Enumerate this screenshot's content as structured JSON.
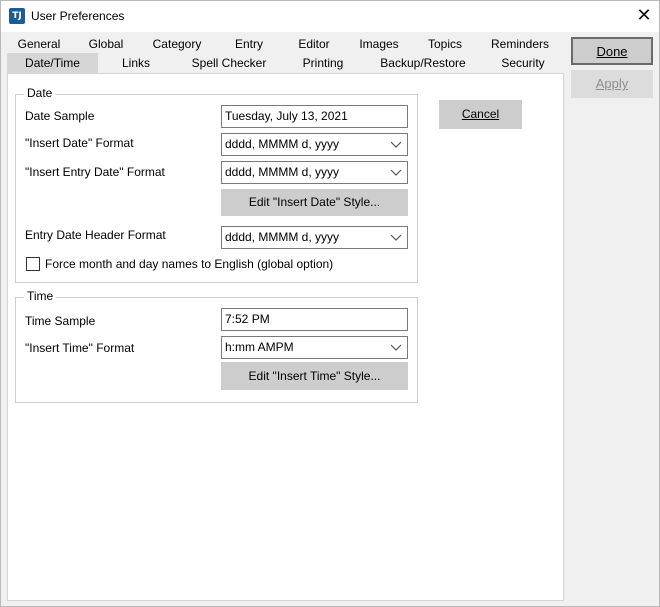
{
  "window": {
    "title": "User Preferences",
    "icon_text": "TJ"
  },
  "tabs_row1": [
    {
      "label": "General"
    },
    {
      "label": "Global"
    },
    {
      "label": "Category"
    },
    {
      "label": "Entry"
    },
    {
      "label": "Editor"
    },
    {
      "label": "Images"
    },
    {
      "label": "Topics"
    },
    {
      "label": "Reminders"
    }
  ],
  "tabs_row2": [
    {
      "label": "Date/Time",
      "active": true
    },
    {
      "label": "Links"
    },
    {
      "label": "Spell Checker"
    },
    {
      "label": "Printing"
    },
    {
      "label": "Backup/Restore"
    },
    {
      "label": "Security"
    }
  ],
  "date_group": {
    "title": "Date",
    "date_sample_label": "Date Sample",
    "date_sample_value": "Tuesday, July 13, 2021",
    "insert_date_label": "\"Insert Date\" Format",
    "insert_date_value": "dddd, MMMM d, yyyy",
    "insert_entry_date_label": "\"Insert Entry Date\" Format",
    "insert_entry_date_value": "dddd, MMMM d, yyyy",
    "edit_style_button": "Edit \"Insert Date\" Style...",
    "entry_header_label": "Entry Date Header Format",
    "entry_header_value": "dddd, MMMM d, yyyy",
    "force_english_label": "Force month and day names to English (global option)",
    "force_english_checked": false
  },
  "time_group": {
    "title": "Time",
    "time_sample_label": "Time Sample",
    "time_sample_value": "7:52 PM",
    "insert_time_label": "\"Insert Time\" Format",
    "insert_time_value": "h:mm AMPM",
    "edit_style_button": "Edit \"Insert Time\" Style..."
  },
  "buttons": {
    "cancel": "Cancel",
    "done": "Done",
    "apply": "Apply"
  }
}
